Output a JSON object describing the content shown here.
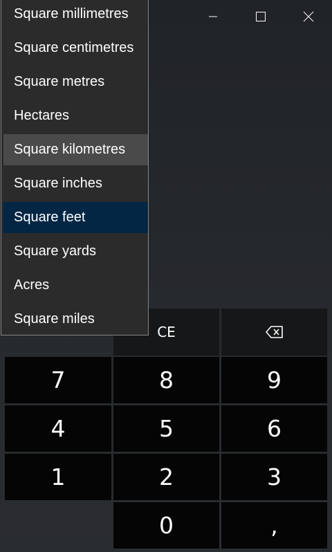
{
  "window": {
    "controls": [
      {
        "name": "minimize-icon"
      },
      {
        "name": "maximize-icon"
      },
      {
        "name": "close-icon"
      }
    ]
  },
  "unit_dropdown": {
    "items": [
      "Square millimetres",
      "Square centimetres",
      "Square metres",
      "Hectares",
      "Square kilometres",
      "Square inches",
      "Square feet",
      "Square yards",
      "Acres",
      "Square miles"
    ],
    "hovered": "Square kilometres",
    "selected": "Square feet"
  },
  "keypad": {
    "ce": "CE",
    "backspace_icon": "backspace-icon",
    "k7": "7",
    "k8": "8",
    "k9": "9",
    "k4": "4",
    "k5": "5",
    "k6": "6",
    "k1": "1",
    "k2": "2",
    "k3": "3",
    "k0": "0",
    "decimal": ","
  },
  "colors": {
    "selected_item": "#032645",
    "hover_item": "#4a4a4a",
    "key_background": "#050505"
  }
}
